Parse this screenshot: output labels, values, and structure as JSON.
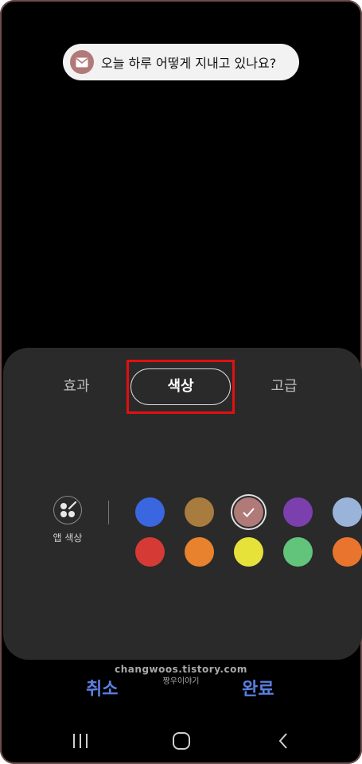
{
  "notification": {
    "text": "오늘 하루 어떻게 지내고 있나요?",
    "icon": "mail-icon"
  },
  "tabs": [
    {
      "label": "효과",
      "selected": false
    },
    {
      "label": "색상",
      "selected": true
    },
    {
      "label": "고급",
      "selected": false
    }
  ],
  "app_color": {
    "label": "앱 색상",
    "icon": "palette-icon"
  },
  "swatches_row1": [
    "#3a66e0",
    "#a87b3e",
    "#b07a78",
    "#7b3fae",
    "#9ab3d8"
  ],
  "swatches_row2": [
    "#d63a35",
    "#e8822e",
    "#e6e23a",
    "#62c47a",
    "#e8742e"
  ],
  "selected_color": "#b07a78",
  "watermark": {
    "line1": "changwoos.tistory.com",
    "line2": "짱우이야기"
  },
  "footer": {
    "cancel_label": "취소",
    "done_label": "완료"
  },
  "navbar": {
    "recent": "recent-apps-icon",
    "home": "home-icon",
    "back": "back-icon"
  }
}
